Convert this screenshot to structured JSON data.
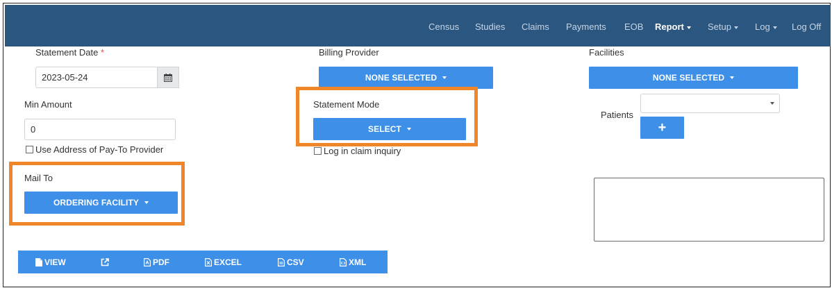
{
  "nav": {
    "items": [
      {
        "label": "Census"
      },
      {
        "label": "Studies"
      },
      {
        "label": "Claims"
      },
      {
        "label": "Payments"
      },
      {
        "label": "EOB"
      },
      {
        "label": "Report"
      },
      {
        "label": "Setup"
      },
      {
        "label": "Log"
      },
      {
        "label": "Log Off"
      }
    ],
    "active": "Report"
  },
  "form": {
    "statement_date": {
      "label": "Statement Date",
      "required_mark": "*",
      "value": "2023-05-24"
    },
    "billing_provider": {
      "label": "Billing Provider",
      "button": "NONE SELECTED"
    },
    "facilities": {
      "label": "Facilities",
      "button": "NONE SELECTED"
    },
    "min_amount": {
      "label": "Min Amount",
      "value": "0"
    },
    "statement_mode": {
      "label": "Statement Mode",
      "button": "SELECT"
    },
    "patients": {
      "label": "Patients",
      "add_label": "+",
      "selected": ""
    },
    "use_address": {
      "label": "Use Address of Pay-To Provider",
      "checked": false
    },
    "log_in_claim": {
      "label": "Log in claim inquiry",
      "checked": false
    },
    "mail_to": {
      "label": "Mail To",
      "button": "ORDERING FACILITY"
    }
  },
  "toolbar": {
    "view": "VIEW",
    "pdf": "PDF",
    "excel": "EXCEL",
    "csv": "CSV",
    "xml": "XML"
  },
  "colors": {
    "navbar": "#2b5680",
    "button": "#3d8fe8",
    "highlight": "#f0862a"
  },
  "icons": [
    "calendar-icon",
    "external-link-icon",
    "file-icon",
    "pdf-file-icon",
    "excel-file-icon",
    "csv-file-icon",
    "xml-file-icon",
    "caret-down-icon",
    "plus-icon"
  ]
}
